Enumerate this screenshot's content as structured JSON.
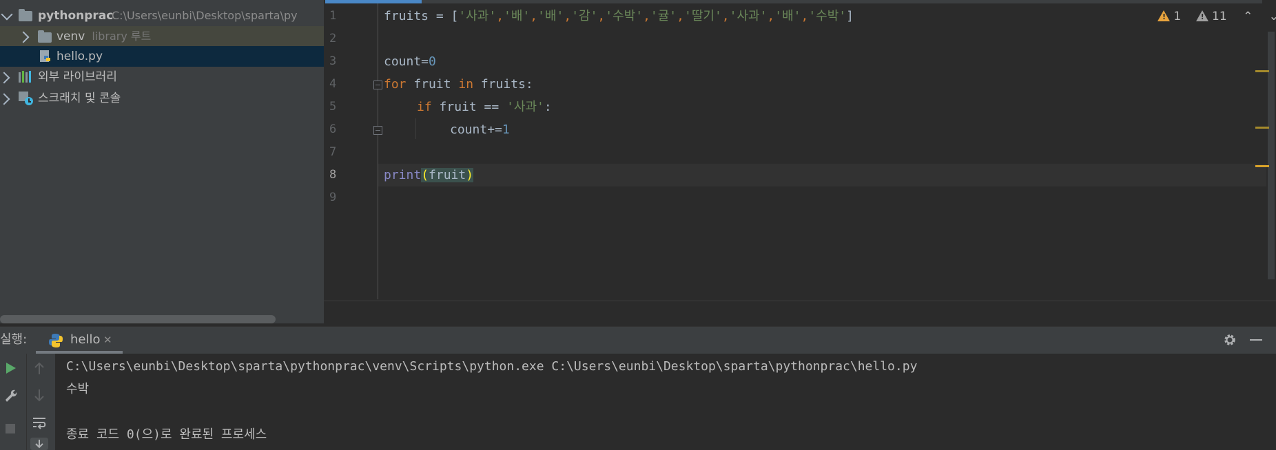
{
  "project": {
    "root": {
      "name": "pythonprac",
      "path": "C:\\Users\\eunbi\\Desktop\\sparta\\py"
    },
    "venv": {
      "name": "venv",
      "hint": "library 루트"
    },
    "file": {
      "name": "hello.py"
    },
    "external_libs": "외부 라이브러리",
    "scratches": "스크래치 및 콘솔"
  },
  "editor": {
    "line_numbers": [
      "1",
      "2",
      "3",
      "4",
      "5",
      "6",
      "7",
      "8",
      "9"
    ],
    "current_line": "8",
    "code": {
      "l1_var": "fruits",
      "l1_op": " = [",
      "l1_items": [
        "'사과'",
        "'배'",
        "'배'",
        "'감'",
        "'수박'",
        "'귤'",
        "'딸기'",
        "'사과'",
        "'배'",
        "'수박'"
      ],
      "l1_sep": ",",
      "l1_close": "]",
      "l3_var": "count=",
      "l3_num": "0",
      "l4_kw1": "for",
      "l4_var": " fruit ",
      "l4_kw2": "in",
      "l4_rest": " fruits:",
      "l5_kw": "if",
      "l5_mid": " fruit == ",
      "l5_str": "'사과'",
      "l5_end": ":",
      "l6_var": "count",
      "l6_op": "+=",
      "l6_num": "1",
      "l8_fn": "print",
      "l8_open": "(",
      "l8_arg": "fruit",
      "l8_close": ")"
    },
    "inspections": {
      "errors": "1",
      "warnings": "11",
      "up": "⌃",
      "down": "⌄"
    }
  },
  "run": {
    "label": "실행:",
    "tab": "hello",
    "tab_close": "✕",
    "output": [
      "C:\\Users\\eunbi\\Desktop\\sparta\\pythonprac\\venv\\Scripts\\python.exe C:\\Users\\eunbi\\Desktop\\sparta\\pythonprac\\hello.py",
      "수박",
      "",
      "종료 코드 0(으)로 완료된 프로세스"
    ]
  },
  "colors": {
    "accent": "#4a88c7",
    "keyword": "#cc7832",
    "string": "#6a8759",
    "number": "#6897bb",
    "warning": "#e8a33d"
  }
}
